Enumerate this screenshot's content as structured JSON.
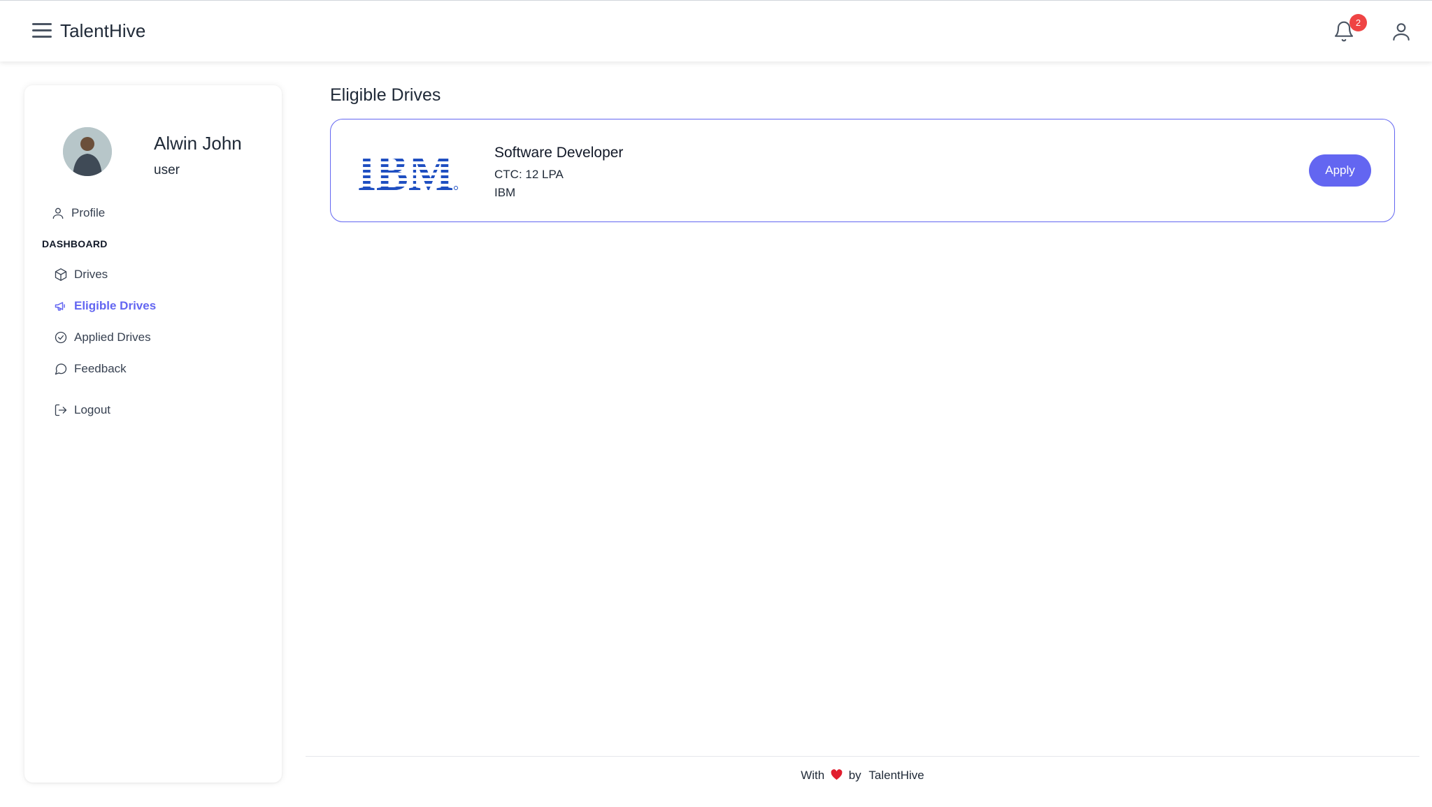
{
  "header": {
    "brand": "TalentHive",
    "notification_count": "2",
    "icons": [
      "menu-icon",
      "bell-icon",
      "user-icon"
    ]
  },
  "sidebar": {
    "user": {
      "name": "Alwin John",
      "role": "user"
    },
    "profile_label": "Profile",
    "section_label": "DASHBOARD",
    "items": [
      {
        "label": "Drives",
        "icon": "box-icon",
        "active": false
      },
      {
        "label": "Eligible Drives",
        "icon": "megaphone-icon",
        "active": true
      },
      {
        "label": "Applied Drives",
        "icon": "check-circle-icon",
        "active": false
      },
      {
        "label": "Feedback",
        "icon": "chat-icon",
        "active": false
      }
    ],
    "logout_label": "Logout"
  },
  "main": {
    "title": "Eligible Drives",
    "drives": [
      {
        "logo": "IBM",
        "title": "Software Developer",
        "ctc": "CTC: 12 LPA",
        "company": "IBM",
        "apply_label": "Apply"
      }
    ]
  },
  "footer": {
    "with": "With",
    "by": "by",
    "brand": "TalentHive"
  },
  "colors": {
    "accent": "#6366f1",
    "badge": "#ef4444",
    "ibm_blue": "#1f4fc1"
  }
}
